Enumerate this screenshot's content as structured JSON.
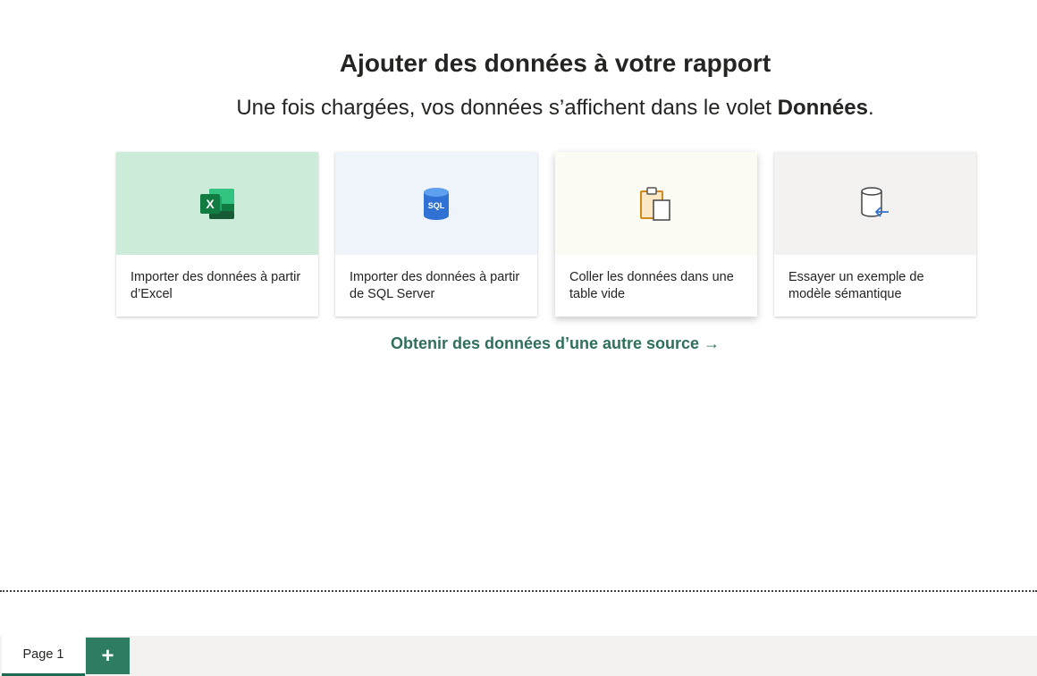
{
  "header": {
    "title": "Ajouter des données à votre rapport",
    "subtitle_prefix": "Une fois chargées, vos données s’affichent dans le volet ",
    "subtitle_bold": "Données",
    "subtitle_suffix": "."
  },
  "cards": [
    {
      "label": "Importer des données à partir d’Excel",
      "icon": "excel-icon",
      "color": "#cdebd9"
    },
    {
      "label": "Importer des données à partir de SQL Server",
      "icon": "sql-server-icon",
      "icon_text": "SQL",
      "color": "#eff4fb"
    },
    {
      "label": "Coller les données dans une table vide",
      "icon": "paste-icon",
      "color": "#fdfcf4"
    },
    {
      "label": "Essayer un exemple de modèle sémantique",
      "icon": "sample-model-icon",
      "color": "#f3f2f1"
    }
  ],
  "other_source_link": "Obtenir des données d’une autre source →",
  "tabs": {
    "pages": [
      {
        "label": "Page 1",
        "active": true
      }
    ],
    "add_page": "+"
  },
  "colors": {
    "accent": "#2e7d63",
    "link": "#2e6f5e"
  }
}
